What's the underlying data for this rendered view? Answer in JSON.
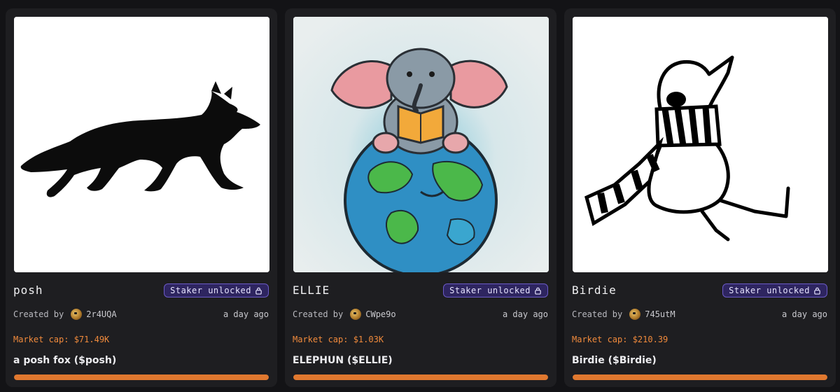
{
  "cards": [
    {
      "name": "posh",
      "badge": "Staker unlocked",
      "badge_icon": "lock-icon",
      "created_by_label": "Created by",
      "creator": "2r4UQA",
      "time": "a day ago",
      "market_cap": "Market cap: $71.49K",
      "ticker": "a posh fox ($posh)",
      "progress": 1.0,
      "image": "black-fox-silhouette"
    },
    {
      "name": "ELLIE",
      "badge": "Staker unlocked",
      "badge_icon": "lock-icon",
      "created_by_label": "Created by",
      "creator": "CWpe9o",
      "time": "a day ago",
      "market_cap": "Market cap: $1.03K",
      "ticker": "ELEPHUN ($ELLIE)",
      "progress": 1.0,
      "image": "elephant-reading-on-globe"
    },
    {
      "name": "Birdie",
      "badge": "Staker unlocked",
      "badge_icon": "lock-icon",
      "created_by_label": "Created by",
      "creator": "745utM",
      "time": "a day ago",
      "market_cap": "Market cap: $210.39",
      "ticker": "Birdie ($Birdie)",
      "progress": 1.0,
      "image": "bird-with-scarf-drawing"
    }
  ],
  "colors": {
    "page_bg": "#131316",
    "card_bg": "#1e1e21",
    "accent_orange": "#e0782f",
    "market_cap_text": "#f08a3c",
    "badge_bg": "#2e2560",
    "badge_border": "#6b5ac7"
  }
}
